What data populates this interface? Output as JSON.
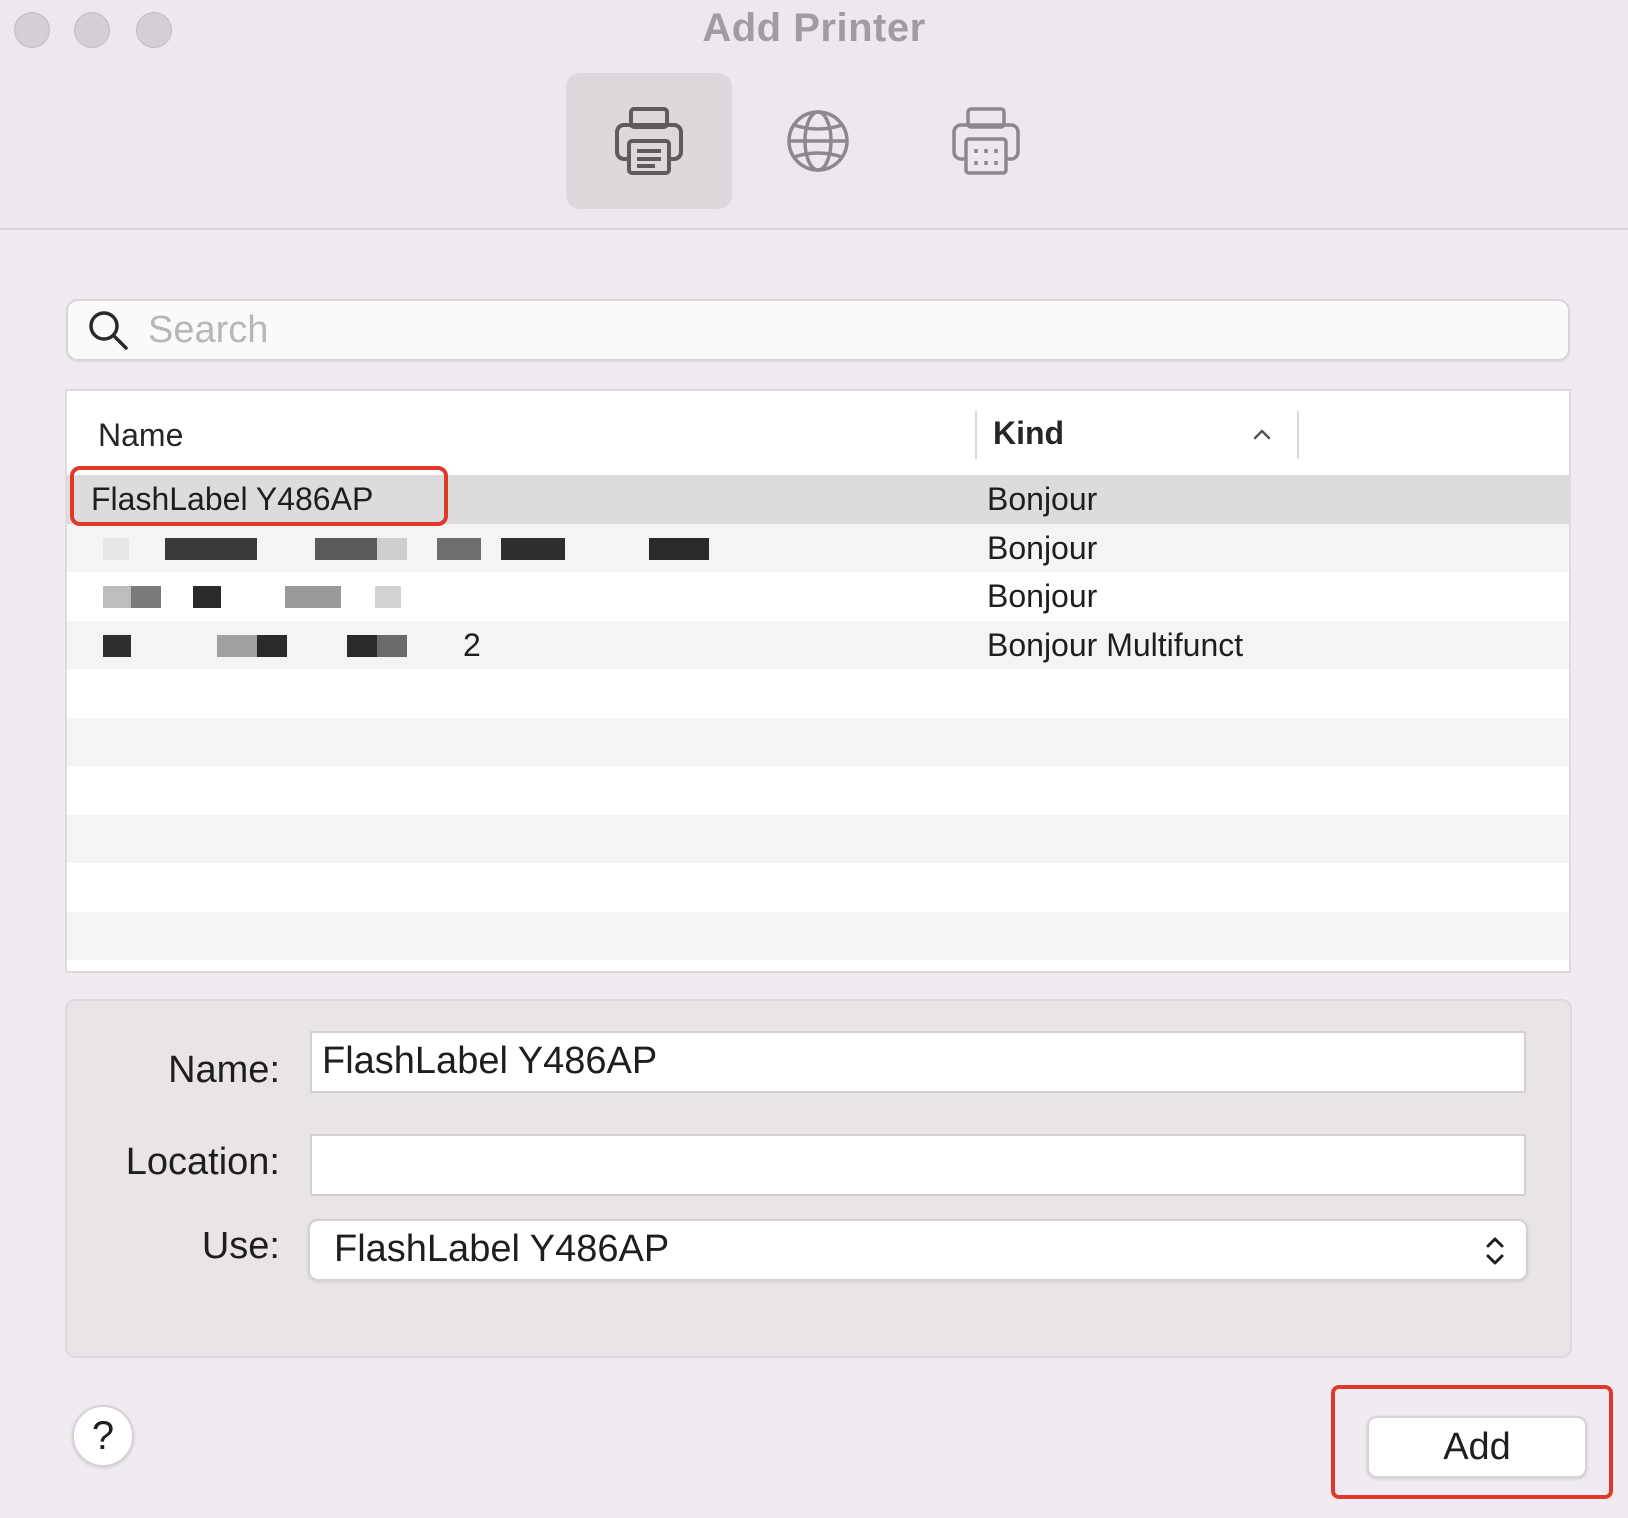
{
  "window": {
    "title": "Add Printer"
  },
  "toolbar": {
    "buttons": [
      {
        "icon": "printer-icon",
        "selected": true
      },
      {
        "icon": "globe-icon",
        "selected": false
      },
      {
        "icon": "fax-printer-icon",
        "selected": false
      }
    ]
  },
  "search": {
    "placeholder": "Search",
    "value": ""
  },
  "table": {
    "columns": {
      "name": "Name",
      "kind": "Kind"
    },
    "rows": [
      {
        "name": "FlashLabel Y486AP",
        "kind": "Bonjour",
        "selected": true
      },
      {
        "name": "",
        "kind": "Bonjour",
        "selected": false
      },
      {
        "name": "",
        "kind": "Bonjour",
        "selected": false
      },
      {
        "name": "2",
        "kind": "Bonjour Multifunct",
        "selected": false
      }
    ]
  },
  "details": {
    "name_label": "Name:",
    "name_value": "FlashLabel Y486AP",
    "location_label": "Location:",
    "location_value": "",
    "use_label": "Use:",
    "use_value": "FlashLabel Y486AP"
  },
  "buttons": {
    "help": "?",
    "add": "Add"
  },
  "colors": {
    "highlight": "#e0392b"
  }
}
